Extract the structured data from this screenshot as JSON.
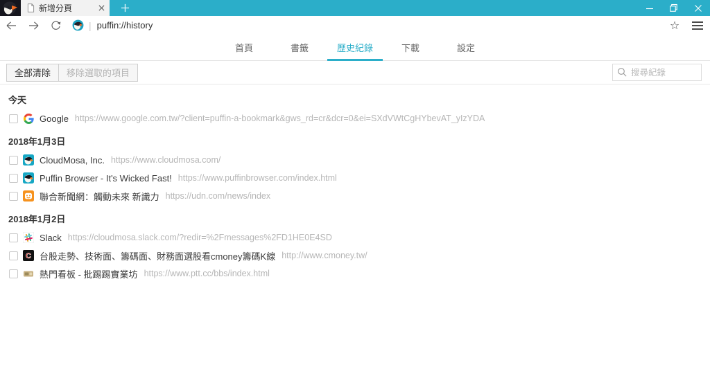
{
  "titlebar": {
    "tab_title": "新增分頁"
  },
  "toolbar": {
    "url": "puffin://history"
  },
  "nav": {
    "tabs": [
      {
        "label": "首頁",
        "active": false
      },
      {
        "label": "書籤",
        "active": false
      },
      {
        "label": "歷史紀錄",
        "active": true
      },
      {
        "label": "下載",
        "active": false
      },
      {
        "label": "設定",
        "active": false
      }
    ]
  },
  "action_bar": {
    "clear_all_label": "全部清除",
    "remove_selected_label": "移除選取的項目",
    "search_placeholder": "搜尋紀錄"
  },
  "history": {
    "sections": [
      {
        "date": "今天",
        "items": [
          {
            "favicon": "google",
            "title": "Google",
            "url": "https://www.google.com.tw/?client=puffin-a-bookmark&gws_rd=cr&dcr=0&ei=SXdVWtCgHYbevAT_yIzYDA",
            "checked": false
          }
        ]
      },
      {
        "date": "2018年1月3日",
        "items": [
          {
            "favicon": "puffin",
            "title": "CloudMosa, Inc.",
            "url": "https://www.cloudmosa.com/",
            "checked": false
          },
          {
            "favicon": "puffin",
            "title": "Puffin Browser - It's Wicked Fast!",
            "url": "https://www.puffinbrowser.com/index.html",
            "checked": false
          },
          {
            "favicon": "udn",
            "title": "聯合新聞網：觸動未來 新識力",
            "url": "https://udn.com/news/index",
            "checked": false
          }
        ]
      },
      {
        "date": "2018年1月2日",
        "items": [
          {
            "favicon": "slack",
            "title": "Slack",
            "url": "https://cloudmosa.slack.com/?redir=%2Fmessages%2FD1HE0E4SD",
            "checked": false
          },
          {
            "favicon": "cmoney",
            "title": "台股走勢、技術面、籌碼面、財務面選股看cmoney籌碼K線",
            "url": "http://www.cmoney.tw/",
            "checked": false
          },
          {
            "favicon": "ptt",
            "title": "熱門看板 - 批踢踢實業坊",
            "url": "https://www.ptt.cc/bbs/index.html",
            "checked": false
          }
        ]
      }
    ]
  },
  "icons": {
    "star": "☆",
    "address_separator": "|"
  },
  "colors": {
    "accent_teal": "#2BAEC9",
    "logo_background": "#15151D",
    "url_gray": "#B6B6B6"
  }
}
